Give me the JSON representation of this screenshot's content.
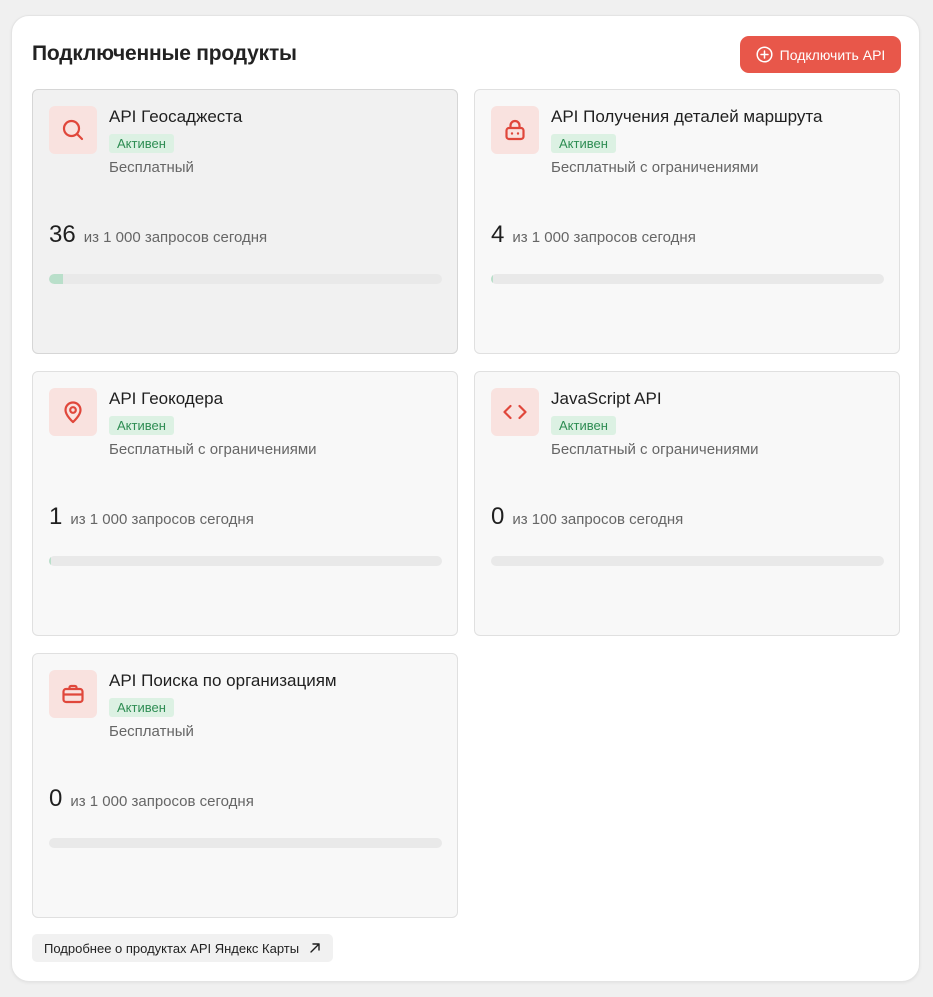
{
  "header": {
    "title": "Подключенные продукты",
    "connect_button_label": "Подключить API"
  },
  "products": [
    {
      "name": "API Геосаджеста",
      "icon": "search-icon",
      "status": "Активен",
      "plan": "Бесплатный",
      "used": "36",
      "limit_text": "из 1 000 запросов сегодня",
      "progress_fraction": 0.036
    },
    {
      "name": "API Получения деталей маршрута",
      "icon": "lock-icon",
      "status": "Активен",
      "plan": "Бесплатный с ограничениями",
      "used": "4",
      "limit_text": "из 1 000 запросов сегодня",
      "progress_fraction": 0.004
    },
    {
      "name": "API Геокодера",
      "icon": "map-pin-icon",
      "status": "Активен",
      "plan": "Бесплатный с ограничениями",
      "used": "1",
      "limit_text": "из 1 000 запросов сегодня",
      "progress_fraction": 0.001
    },
    {
      "name": "JavaScript API",
      "icon": "code-brackets-icon",
      "status": "Активен",
      "plan": "Бесплатный с ограничениями",
      "used": "0",
      "limit_text": "из 100 запросов сегодня",
      "progress_fraction": 0
    },
    {
      "name": "API Поиска по организациям",
      "icon": "briefcase-icon",
      "status": "Активен",
      "plan": "Бесплатный",
      "used": "0",
      "limit_text": "из 1 000 запросов сегодня",
      "progress_fraction": 0
    }
  ],
  "footer": {
    "more_link_label": "Подробнее о продуктах API Яндекс Карты"
  },
  "colors": {
    "accent": "#e8574a",
    "icon_tile": "#f9e2df",
    "badge_bg": "#dcf1e3",
    "badge_text": "#2e8d53",
    "progress_fill": "#b9dfca"
  }
}
